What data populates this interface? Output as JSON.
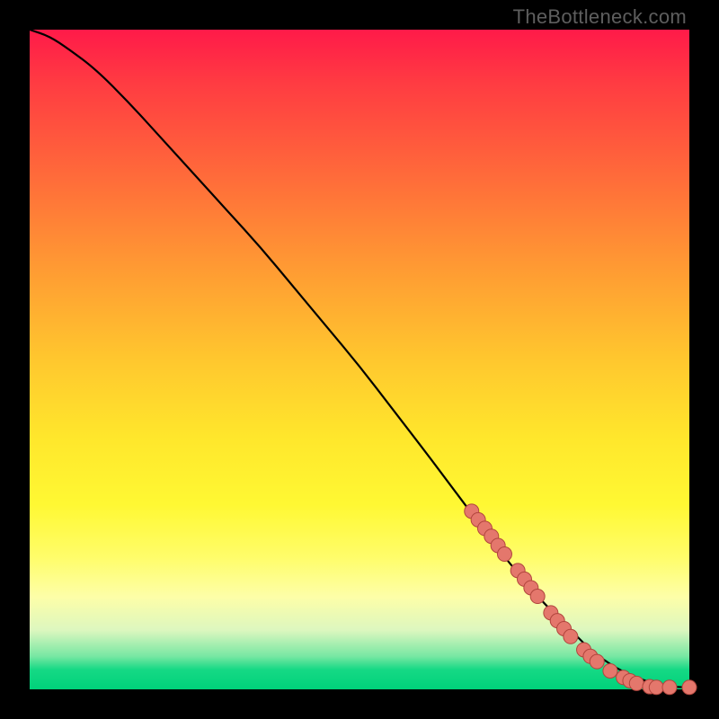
{
  "watermark": "TheBottleneck.com",
  "colors": {
    "line": "#000000",
    "point_fill": "#e4776c",
    "point_stroke": "#b1453d",
    "bg_black": "#000000"
  },
  "chart_data": {
    "type": "line",
    "title": "",
    "xlabel": "",
    "ylabel": "",
    "xlim": [
      0,
      100
    ],
    "ylim": [
      0,
      100
    ],
    "series": [
      {
        "name": "curve",
        "x": [
          0,
          3,
          6,
          10,
          15,
          20,
          25,
          30,
          35,
          40,
          45,
          50,
          55,
          60,
          63,
          66,
          69,
          72,
          75,
          78,
          81,
          83,
          85,
          87,
          89,
          91,
          93,
          95,
          97,
          100
        ],
        "y": [
          100,
          99,
          97,
          94,
          89,
          83.5,
          78,
          72.5,
          67,
          61,
          55,
          49,
          42.5,
          36,
          32,
          28,
          24,
          20,
          16.5,
          13,
          10,
          8,
          6,
          4.5,
          3.2,
          2.2,
          1.4,
          0.8,
          0.4,
          0.3
        ]
      }
    ],
    "points": [
      {
        "x": 67,
        "y": 27.0
      },
      {
        "x": 68,
        "y": 25.7
      },
      {
        "x": 69,
        "y": 24.4
      },
      {
        "x": 70,
        "y": 23.2
      },
      {
        "x": 71,
        "y": 21.8
      },
      {
        "x": 72,
        "y": 20.5
      },
      {
        "x": 74,
        "y": 18.0
      },
      {
        "x": 75,
        "y": 16.7
      },
      {
        "x": 76,
        "y": 15.4
      },
      {
        "x": 77,
        "y": 14.1
      },
      {
        "x": 79,
        "y": 11.6
      },
      {
        "x": 80,
        "y": 10.4
      },
      {
        "x": 81,
        "y": 9.2
      },
      {
        "x": 82,
        "y": 8.0
      },
      {
        "x": 84,
        "y": 6.0
      },
      {
        "x": 85,
        "y": 5.0
      },
      {
        "x": 86,
        "y": 4.2
      },
      {
        "x": 88,
        "y": 2.8
      },
      {
        "x": 90,
        "y": 1.8
      },
      {
        "x": 91,
        "y": 1.3
      },
      {
        "x": 92,
        "y": 0.9
      },
      {
        "x": 94,
        "y": 0.4
      },
      {
        "x": 95,
        "y": 0.3
      },
      {
        "x": 97,
        "y": 0.3
      },
      {
        "x": 100,
        "y": 0.3
      }
    ]
  }
}
